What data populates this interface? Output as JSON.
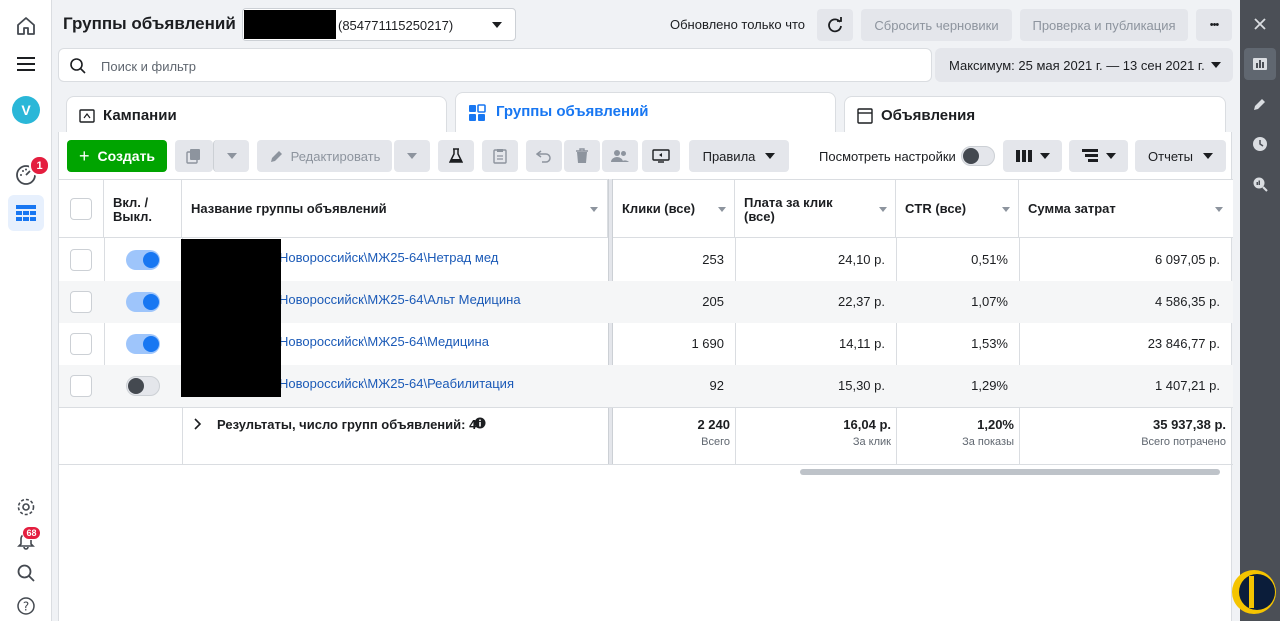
{
  "header": {
    "title": "Группы объявлений",
    "account_id": "(854771115250217)",
    "updated": "Обновлено только что",
    "discard_drafts": "Сбросить черновики",
    "review_publish": "Проверка и публикация",
    "more": "•••"
  },
  "search": {
    "placeholder": "Поиск и фильтр"
  },
  "date_range": "Максимум: 25 мая 2021 г. — 13 сен 2021 г.",
  "tabs": [
    {
      "label": "Кампании"
    },
    {
      "label": "Группы объявлений"
    },
    {
      "label": "Объявления"
    }
  ],
  "toolbar": {
    "create": "Создать",
    "edit": "Редактировать",
    "rules": "Правила",
    "view_settings": "Посмотреть настройки",
    "reports": "Отчеты"
  },
  "nav": {
    "avatar_letter": "V",
    "activity_badge": "1",
    "notifications_badge": "68"
  },
  "table": {
    "headers": {
      "toggle": "Вкл. / Выкл.",
      "name": "Название группы объявлений",
      "clicks": "Клики (все)",
      "cpc_line1": "Плата за клик",
      "cpc_line2": "(все)",
      "ctr": "CTR (все)",
      "spend": "Сумма затрат"
    },
    "rows": [
      {
        "on": true,
        "name": "Новороссийск\\МЖ25-64\\Нетрад мед",
        "clicks": "253",
        "cpc": "24,10 р.",
        "ctr": "0,51%",
        "spend": "6 097,05 р."
      },
      {
        "on": true,
        "name": "Новороссийск\\МЖ25-64\\Альт Медицина",
        "clicks": "205",
        "cpc": "22,37 р.",
        "ctr": "1,07%",
        "spend": "4 586,35 р."
      },
      {
        "on": true,
        "name": "Новороссийск\\МЖ25-64\\Медицина",
        "clicks": "1 690",
        "cpc": "14,11 р.",
        "ctr": "1,53%",
        "spend": "23 846,77 р."
      },
      {
        "on": false,
        "name": "Новороссийск\\МЖ25-64\\Реабилитация",
        "clicks": "92",
        "cpc": "15,30 р.",
        "ctr": "1,29%",
        "spend": "1 407,21 р."
      }
    ],
    "summary": {
      "label": "Результаты, число групп объявлений: 4",
      "clicks": "2 240",
      "clicks_sub": "Всего",
      "cpc": "16,04 р.",
      "cpc_sub": "За клик",
      "ctr": "1,20%",
      "ctr_sub": "За показы",
      "spend": "35 937,38 р.",
      "spend_sub": "Всего потрачено"
    }
  },
  "colors": {
    "accent": "#1877f2",
    "create": "#00a400",
    "badge": "#e41e3f",
    "rail": "#4b4f56"
  }
}
